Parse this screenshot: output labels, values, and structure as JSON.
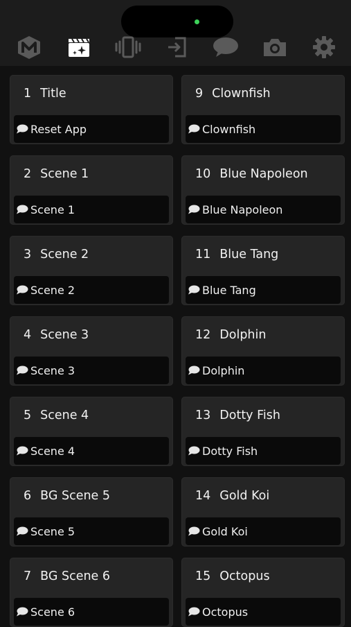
{
  "colors": {
    "background": "#111111",
    "topbar": "#1c1c1c",
    "card": "#252525",
    "action_bar": "#0a0a0a",
    "icon_inactive": "#5a5a5a",
    "icon_active": "#ffffff",
    "status_dot": "#3dd25a"
  },
  "toolbar": {
    "tabs": [
      {
        "icon": "logo-m-icon",
        "active": false
      },
      {
        "icon": "clapperboard-sparkle-icon",
        "active": true
      },
      {
        "icon": "vibrate-icon",
        "active": false
      },
      {
        "icon": "import-arrow-icon",
        "active": false
      },
      {
        "icon": "chat-bubble-icon",
        "active": false
      },
      {
        "icon": "camera-icon",
        "active": false
      },
      {
        "icon": "gear-icon",
        "active": false
      }
    ]
  },
  "scenes": [
    {
      "number": "1",
      "title": "Title",
      "action": "Reset App"
    },
    {
      "number": "9",
      "title": "Clownfish",
      "action": "Clownfish"
    },
    {
      "number": "2",
      "title": "Scene 1",
      "action": "Scene 1"
    },
    {
      "number": "10",
      "title": "Blue Napoleon",
      "action": "Blue Napoleon"
    },
    {
      "number": "3",
      "title": "Scene 2",
      "action": "Scene 2"
    },
    {
      "number": "11",
      "title": "Blue Tang",
      "action": "Blue Tang"
    },
    {
      "number": "4",
      "title": "Scene 3",
      "action": "Scene 3"
    },
    {
      "number": "12",
      "title": "Dolphin",
      "action": "Dolphin"
    },
    {
      "number": "5",
      "title": "Scene 4",
      "action": "Scene 4"
    },
    {
      "number": "13",
      "title": "Dotty Fish",
      "action": "Dotty Fish"
    },
    {
      "number": "6",
      "title": "BG Scene 5",
      "action": "Scene 5"
    },
    {
      "number": "14",
      "title": "Gold Koi",
      "action": "Gold Koi"
    },
    {
      "number": "7",
      "title": "BG Scene 6",
      "action": "Scene 6"
    },
    {
      "number": "15",
      "title": "Octopus",
      "action": "Octopus"
    }
  ]
}
